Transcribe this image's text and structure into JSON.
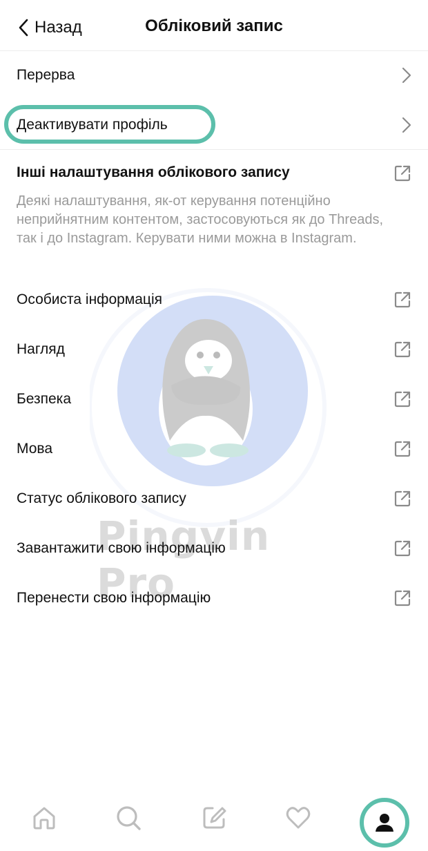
{
  "header": {
    "back_label": "Назад",
    "title": "Обліковий запис"
  },
  "rows_top": [
    {
      "label": "Перерва",
      "icon": "chevron-right-icon"
    },
    {
      "label": "Деактивувати профіль",
      "icon": "chevron-right-icon"
    }
  ],
  "other": {
    "title": "Інші налаштування облікового запису",
    "description": "Деякі налаштування, як-от керування потенційно неприйнятним контентом, застосовуються як до Threads, так і до Instagram. Керувати ними можна в Instagram.",
    "icon": "external-link-icon"
  },
  "rows_external": [
    {
      "label": "Особиста інформація",
      "icon": "external-link-icon"
    },
    {
      "label": "Нагляд",
      "icon": "external-link-icon"
    },
    {
      "label": "Безпека",
      "icon": "external-link-icon"
    },
    {
      "label": "Мова",
      "icon": "external-link-icon"
    },
    {
      "label": "Статус облікового запису",
      "icon": "external-link-icon"
    },
    {
      "label": "Завантажити свою інформацію",
      "icon": "external-link-icon"
    },
    {
      "label": "Перенести свою інформацію",
      "icon": "external-link-icon"
    }
  ],
  "watermark": {
    "text": "Pingvin Pro"
  },
  "nav": {
    "items": [
      "home-icon",
      "search-icon",
      "compose-icon",
      "heart-icon",
      "profile-icon"
    ],
    "active": "profile-icon"
  },
  "colors": {
    "highlight": "#5cbfab",
    "text": "#111111",
    "muted": "#9a9a9a",
    "icon": "#8a8a8a",
    "divider": "#ececec"
  }
}
